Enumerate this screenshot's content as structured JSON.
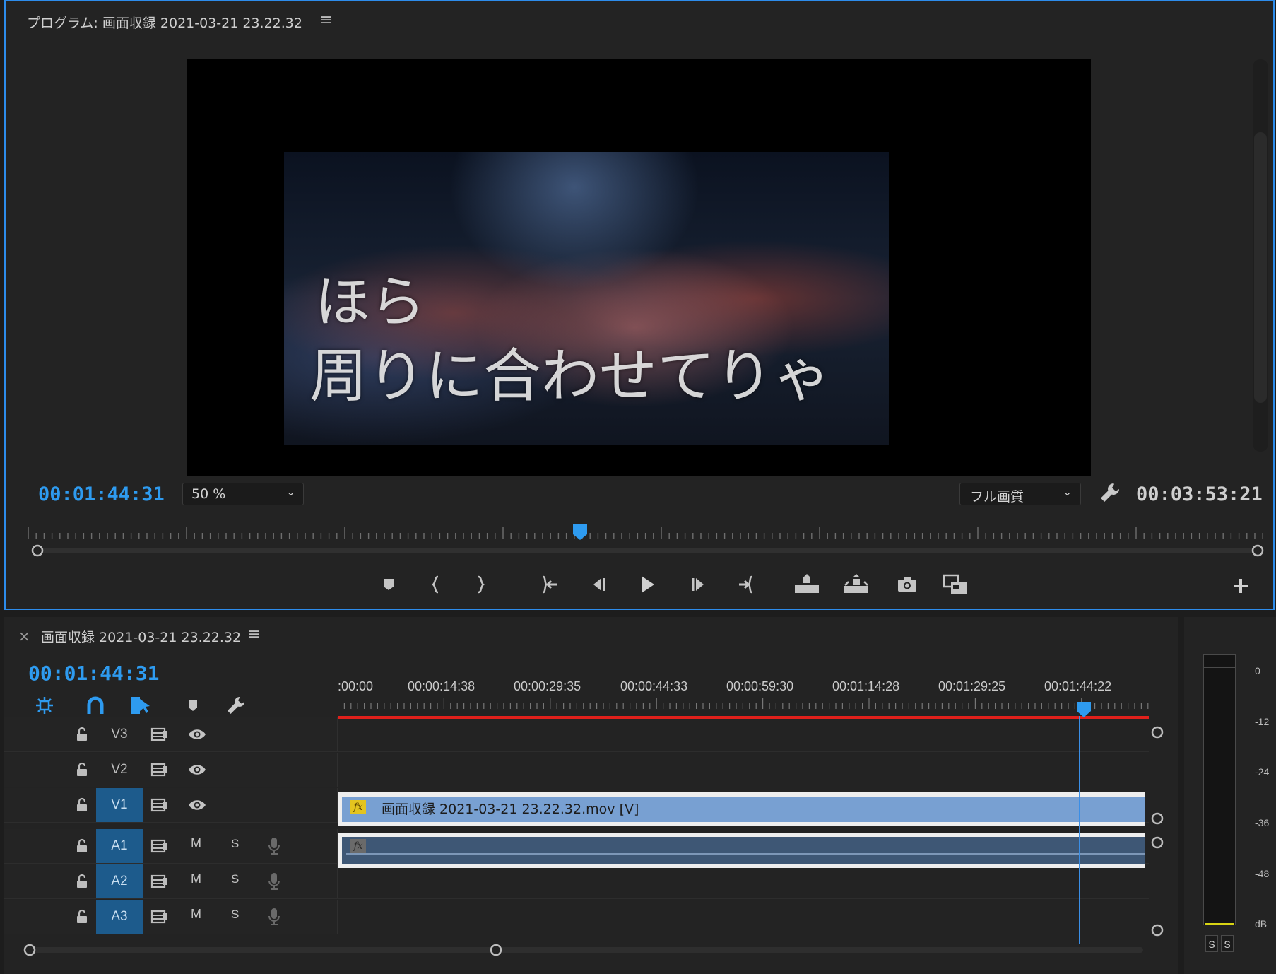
{
  "program_monitor": {
    "title": "プログラム: 画面収録 2021-03-21 23.22.32",
    "menu_icon": "hamburger-menu-icon",
    "lyrics": [
      "ほら",
      "周りに合わせてりゃ"
    ],
    "current_timecode": "00:01:44:31",
    "zoom_level": "50 %",
    "playback_resolution": "フル画質",
    "duration": "00:03:53:21",
    "playhead_position": 0.445,
    "transport_controls": [
      "marker-icon",
      "mark-in-icon",
      "mark-out-icon",
      "go-to-in-icon",
      "step-back-icon",
      "play-icon",
      "step-forward-icon",
      "go-to-out-icon",
      "lift-icon",
      "extract-icon",
      "export-frame-icon",
      "comparison-view-icon",
      "add-icon"
    ]
  },
  "timeline": {
    "close_icon": "×",
    "title": "画面収録 2021-03-21 23.22.32",
    "current_timecode": "00:01:44:31",
    "tools": [
      "nest-sequence-icon",
      "snap-icon",
      "linked-selection-icon",
      "add-marker-icon",
      "wrench-icon"
    ],
    "ruler_labels": [
      ":00:00",
      "00:00:14:38",
      "00:00:29:35",
      "00:00:44:33",
      "00:00:59:30",
      "00:01:14:28",
      "00:01:29:25",
      "00:01:44:22"
    ],
    "video_tracks": [
      {
        "name": "V3",
        "active": false
      },
      {
        "name": "V2",
        "active": false
      },
      {
        "name": "V1",
        "active": true
      }
    ],
    "audio_tracks": [
      {
        "name": "A1",
        "mute": "M",
        "solo": "S"
      },
      {
        "name": "A2",
        "mute": "M",
        "solo": "S"
      },
      {
        "name": "A3",
        "mute": "M",
        "solo": "S"
      }
    ],
    "video_clip": {
      "label": "画面収録 2021-03-21 23.22.32.mov [V]",
      "fx": "fx"
    },
    "audio_clip": {
      "fx": "fx"
    }
  },
  "audio_meter": {
    "scale": [
      "0",
      "-12",
      "-24",
      "-36",
      "-48",
      "dB"
    ],
    "solo_buttons": [
      "S",
      "S"
    ]
  },
  "colors": {
    "accent_blue": "#2e9bf0",
    "work_area_red": "#e0201b",
    "video_clip": "#78a0d2",
    "audio_clip": "#3e5775",
    "track_selected": "#1d5b8c"
  }
}
